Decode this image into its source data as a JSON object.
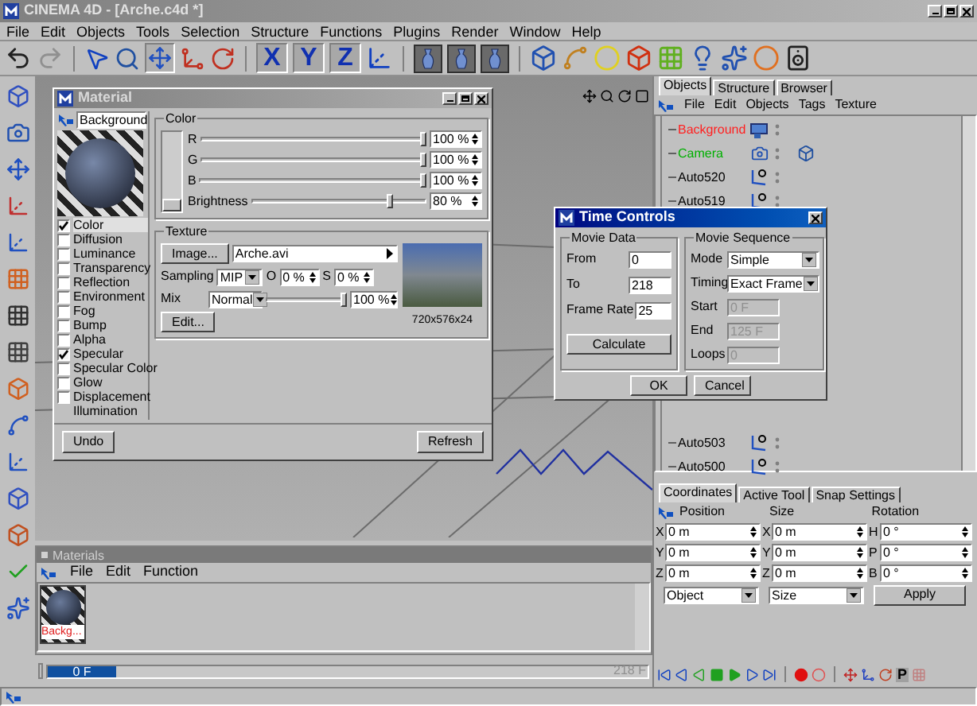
{
  "window": {
    "title": "CINEMA 4D - [Arche.c4d *]"
  },
  "menu": [
    "File",
    "Edit",
    "Objects",
    "Tools",
    "Selection",
    "Structure",
    "Functions",
    "Plugins",
    "Render",
    "Window",
    "Help"
  ],
  "axis_buttons": [
    {
      "label": "X",
      "selected": true
    },
    {
      "label": "Y",
      "selected": true
    },
    {
      "label": "Z",
      "selected": true
    }
  ],
  "material_window": {
    "title": "Material",
    "name": "Background",
    "channels": [
      {
        "label": "Color",
        "kind": "check",
        "checked": true,
        "selected": true
      },
      {
        "label": "Diffusion",
        "kind": "check",
        "checked": false,
        "selected": false
      },
      {
        "label": "Luminance",
        "kind": "check",
        "checked": false,
        "selected": false
      },
      {
        "label": "Transparency",
        "kind": "check",
        "checked": false,
        "selected": false
      },
      {
        "label": "Reflection",
        "kind": "check",
        "checked": false,
        "selected": false
      },
      {
        "label": "Environment",
        "kind": "check",
        "checked": false,
        "selected": false
      },
      {
        "label": "Fog",
        "kind": "check",
        "checked": false,
        "selected": false
      },
      {
        "label": "Bump",
        "kind": "check",
        "checked": false,
        "selected": false
      },
      {
        "label": "Alpha",
        "kind": "check",
        "checked": false,
        "selected": false
      },
      {
        "label": "Specular",
        "kind": "check",
        "checked": true,
        "selected": false
      },
      {
        "label": "Specular Color",
        "kind": "check",
        "checked": false,
        "selected": false
      },
      {
        "label": "Glow",
        "kind": "check",
        "checked": false,
        "selected": false
      },
      {
        "label": "Displacement",
        "kind": "check",
        "checked": false,
        "selected": false
      },
      {
        "label": "Illumination",
        "kind": "plain",
        "selected": false
      }
    ],
    "color_group": {
      "title": "Color",
      "sliders": [
        {
          "label": "R",
          "level": 1,
          "value": "100 %"
        },
        {
          "label": "G",
          "level": 1,
          "value": "100 %"
        },
        {
          "label": "B",
          "level": 1,
          "value": "100 %"
        },
        {
          "label": "Brightness",
          "level": 0.8,
          "value": "80 %"
        }
      ]
    },
    "texture_group": {
      "title": "Texture",
      "image_button": "Image...",
      "file": "Arche.avi",
      "sampling_label": "Sampling",
      "sampling": "MIP",
      "o_label": "O",
      "o_value": "0 %",
      "s_label": "S",
      "s_value": "0 %",
      "mix_label": "Mix",
      "mix": "Normal",
      "mix_slider": {
        "level": 1
      },
      "mix_value": "100 %",
      "edit_button": "Edit...",
      "image_size": "720x576x24"
    },
    "buttons": [
      "Undo",
      "Refresh"
    ]
  },
  "time_controls": {
    "title": "Time Controls",
    "movie_data": {
      "title": "Movie Data",
      "fields": [
        {
          "label": "From",
          "value": "0"
        },
        {
          "label": "To",
          "value": "218"
        },
        {
          "label": "Frame Rate",
          "value": "25"
        }
      ],
      "button": "Calculate"
    },
    "movie_sequence": {
      "title": "Movie Sequence",
      "fields": [
        {
          "label": "Mode",
          "value": "Simple",
          "kind": "dropdown",
          "disabled": false
        },
        {
          "label": "Timing",
          "value": "Exact Frame",
          "kind": "dropdown",
          "disabled": false
        },
        {
          "label": "Start",
          "value": "0 F",
          "kind": "text",
          "disabled": true
        },
        {
          "label": "End",
          "value": "125 F",
          "kind": "text",
          "disabled": true
        },
        {
          "label": "Loops",
          "value": "0",
          "kind": "text",
          "disabled": true
        }
      ]
    },
    "buttons": [
      "OK",
      "Cancel"
    ]
  },
  "objects_panel": {
    "tabs": [
      {
        "label": "Objects",
        "selected": true
      },
      {
        "label": "Structure",
        "selected": false
      },
      {
        "label": "Browser",
        "selected": false
      }
    ],
    "menu": [
      "File",
      "Edit",
      "Objects",
      "Tags",
      "Texture"
    ],
    "items_top": [
      {
        "name": "Background",
        "kind": "background",
        "color": "#ff2020"
      },
      {
        "name": "Camera",
        "kind": "camera",
        "color": "#00b000"
      },
      {
        "name": "Auto520",
        "kind": "null",
        "color": "#000000"
      },
      {
        "name": "Auto519",
        "kind": "null",
        "color": "#000000"
      }
    ],
    "items_bottom": [
      {
        "name": "Auto503",
        "kind": "null",
        "color": "#000000"
      },
      {
        "name": "Auto500",
        "kind": "null",
        "color": "#000000"
      }
    ]
  },
  "coordinates": {
    "tabs": [
      {
        "label": "Coordinates",
        "selected": true
      },
      {
        "label": "Active Tool",
        "selected": false
      },
      {
        "label": "Snap Settings",
        "selected": false
      }
    ],
    "headers": [
      "Position",
      "Size",
      "Rotation"
    ],
    "rows": [
      {
        "p_label": "X",
        "p": "0 m",
        "s_label": "X",
        "s": "0 m",
        "r_label": "H",
        "r": "0 °"
      },
      {
        "p_label": "Y",
        "p": "0 m",
        "s_label": "Y",
        "s": "0 m",
        "r_label": "P",
        "r": "0 °"
      },
      {
        "p_label": "Z",
        "p": "0 m",
        "s_label": "Z",
        "s": "0 m",
        "r_label": "B",
        "r": "0 °"
      }
    ],
    "dropdowns": [
      "Object",
      "Size"
    ],
    "button": "Apply"
  },
  "materials_panel": {
    "title": "Materials",
    "menu": [
      "File",
      "Edit",
      "Function"
    ],
    "items": [
      "Backg..."
    ]
  },
  "timeline": {
    "current": "0 F",
    "end": "218 F"
  },
  "playback": {
    "p_label": "P"
  }
}
